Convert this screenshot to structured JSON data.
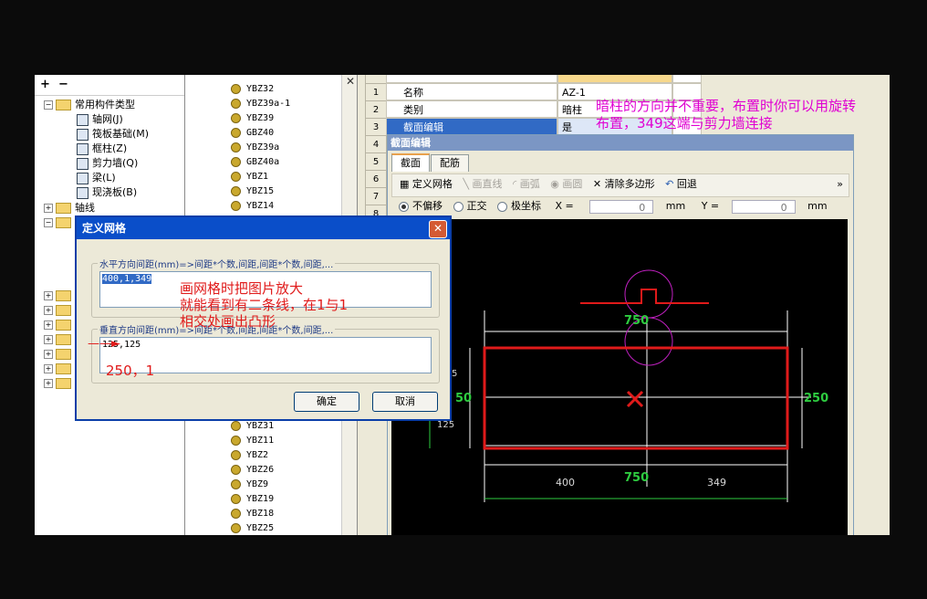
{
  "tree": {
    "root": "常用构件类型",
    "items": [
      "轴网(J)",
      "筏板基础(M)",
      "框柱(Z)",
      "剪力墙(Q)",
      "梁(L)",
      "现浇板(B)"
    ],
    "axis": "轴线"
  },
  "component_list": {
    "top": [
      "YBZ32",
      "YBZ39a-1",
      "YBZ39",
      "GBZ40",
      "YBZ39a",
      "GBZ40a",
      "YBZ1",
      "YBZ15",
      "YBZ14"
    ],
    "bottom": [
      "YBZ31",
      "YBZ11",
      "YBZ2",
      "YBZ26",
      "YBZ9",
      "YBZ19",
      "YBZ18",
      "YBZ25"
    ]
  },
  "properties": {
    "rows": [
      {
        "num": "1",
        "name": "名称",
        "value": "AZ-1"
      },
      {
        "num": "2",
        "name": "类别",
        "value": "暗柱"
      },
      {
        "num": "3",
        "name": "截面编辑",
        "value": "是"
      },
      {
        "num": "4"
      },
      {
        "num": "5"
      },
      {
        "num": "6"
      },
      {
        "num": "7"
      },
      {
        "num": "8"
      }
    ]
  },
  "section_editor": {
    "title": "截面编辑",
    "tabs": [
      "截面",
      "配筋"
    ],
    "toolbar": {
      "define_grid": "定义网格",
      "draw_line": "画直线",
      "draw_arc": "画弧",
      "draw_circle": "画圆",
      "clear_polygon": "清除多边形",
      "undo": "回退",
      "more": "»"
    },
    "options": {
      "no_offset": "不偏移",
      "orthogonal": "正交",
      "polar": "极坐标",
      "x_label": "X =",
      "x_value": "0",
      "x_unit": "mm",
      "y_label": "Y =",
      "y_value": "0",
      "y_unit": "mm"
    },
    "drawing": {
      "dim_top": "750",
      "dim_bottom": "750",
      "dim_right": "250",
      "dim_left": "50",
      "dim_left_small_a": "5",
      "dim_left_small_b": "125",
      "seg_left": "400",
      "seg_right": "349"
    }
  },
  "dialog": {
    "title": "定义网格",
    "close": "✕",
    "horizontal_label": "水平方向间距(mm)=>间距*个数,间距,间距*个数,间距,...",
    "horizontal_value": "400,1,349",
    "vertical_label": "垂直方向间距(mm)=>间距*个数,间距,间距*个数,间距,...",
    "vertical_value": "125,125",
    "ok": "确定",
    "cancel": "取消"
  },
  "annotations": {
    "pink_line1": "暗柱的方向并不重要，布置时你可以用旋转",
    "pink_line2": "布置，349这端与剪力墙连接",
    "red_line1": "画网格时把图片放大",
    "red_line2": "就能看到有二条线，在1与1",
    "red_line3": "相交处画出凸形",
    "red_250": "250，1"
  },
  "colors": {
    "pink": "#e000d2",
    "red": "#e01a1a",
    "dim_green": "#2ecc40",
    "canvas": "#000000"
  }
}
